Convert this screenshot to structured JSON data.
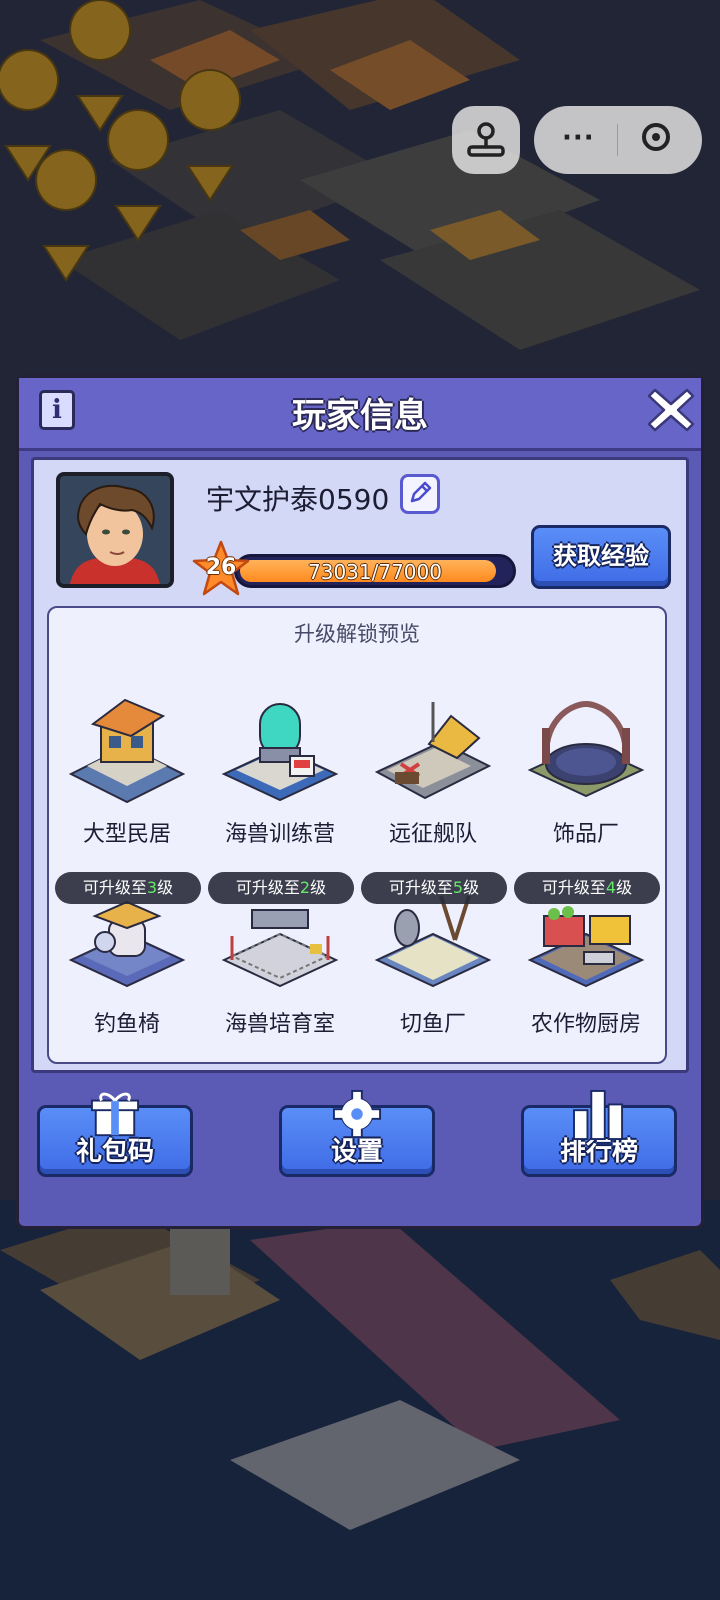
{
  "panel": {
    "title": "玩家信息",
    "info_icon": "info-icon",
    "close_icon": "close-icon"
  },
  "player": {
    "name": "宇文护泰0590",
    "level": "26",
    "xp_text": "73031/77000",
    "xp_current": 73031,
    "xp_max": 77000,
    "get_exp_label": "获取经验"
  },
  "unlock": {
    "title": "升级解锁预览",
    "items": [
      {
        "label": "大型民居",
        "icon": "large-house-icon"
      },
      {
        "label": "海兽训练营",
        "icon": "training-camp-icon"
      },
      {
        "label": "远征舰队",
        "icon": "fleet-icon"
      },
      {
        "label": "饰品厂",
        "icon": "accessory-factory-icon"
      },
      {
        "label": "钓鱼椅",
        "icon": "fishing-chair-icon",
        "badge_prefix": "可升级至",
        "badge_level": "3",
        "badge_suffix": "级"
      },
      {
        "label": "海兽培育室",
        "icon": "breeding-room-icon",
        "badge_prefix": "可升级至",
        "badge_level": "2",
        "badge_suffix": "级"
      },
      {
        "label": "切鱼厂",
        "icon": "fish-cutting-factory-icon",
        "badge_prefix": "可升级至",
        "badge_level": "5",
        "badge_suffix": "级"
      },
      {
        "label": "农作物厨房",
        "icon": "crop-kitchen-icon",
        "badge_prefix": "可升级至",
        "badge_level": "4",
        "badge_suffix": "级"
      }
    ]
  },
  "buttons": {
    "gift_code": "礼包码",
    "settings": "设置",
    "leaderboard": "排行榜"
  },
  "colors": {
    "panel": "#5b5ab4",
    "header": "#6766c8",
    "body": "#d3d8f6",
    "button": "#4a7bef",
    "xp_fill": "#ff8a1e",
    "upgrade_level": "#66e86a"
  }
}
